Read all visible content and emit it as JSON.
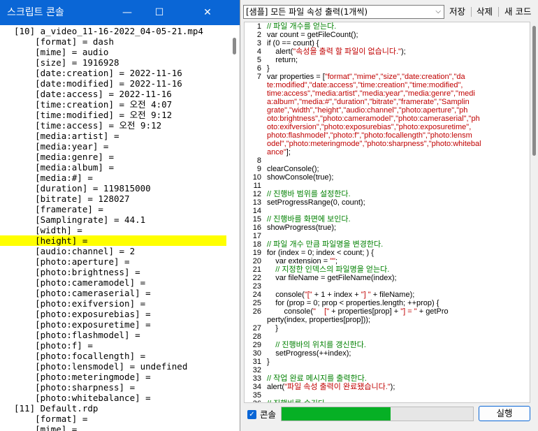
{
  "console_window": {
    "title": "스크립트 콘솔",
    "minimize_glyph": "—",
    "maximize_glyph": "☐",
    "close_glyph": "✕",
    "lines": [
      {
        "text": "[10] a_video_11-16-2022_04-05-21.mp4",
        "highlight": false
      },
      {
        "text": "    [format] = dash",
        "highlight": false
      },
      {
        "text": "    [mime] = audio",
        "highlight": false
      },
      {
        "text": "    [size] = 1916928",
        "highlight": false
      },
      {
        "text": "    [date:creation] = 2022-11-16",
        "highlight": false
      },
      {
        "text": "    [date:modified] = 2022-11-16",
        "highlight": false
      },
      {
        "text": "    [date:access] = 2022-11-16",
        "highlight": false
      },
      {
        "text": "    [time:creation] = 오전 4:07",
        "highlight": false
      },
      {
        "text": "    [time:modified] = 오전 9:12",
        "highlight": false
      },
      {
        "text": "    [time:access] = 오전 9:12",
        "highlight": false
      },
      {
        "text": "    [media:artist] =",
        "highlight": false
      },
      {
        "text": "    [media:year] =",
        "highlight": false
      },
      {
        "text": "    [media:genre] =",
        "highlight": false
      },
      {
        "text": "    [media:album] =",
        "highlight": false
      },
      {
        "text": "    [media:#] =",
        "highlight": false
      },
      {
        "text": "    [duration] = 119815000",
        "highlight": false
      },
      {
        "text": "    [bitrate] = 128027",
        "highlight": false
      },
      {
        "text": "    [framerate] =",
        "highlight": false
      },
      {
        "text": "    [Samplingrate] = 44.1",
        "highlight": false
      },
      {
        "text": "    [width] =",
        "highlight": false
      },
      {
        "text": "    [height] =",
        "highlight": true
      },
      {
        "text": "    [audio:channel] = 2",
        "highlight": false
      },
      {
        "text": "    [photo:aperture] =",
        "highlight": false
      },
      {
        "text": "    [photo:brightness] =",
        "highlight": false
      },
      {
        "text": "    [photo:cameramodel] =",
        "highlight": false
      },
      {
        "text": "    [photo:cameraserial] =",
        "highlight": false
      },
      {
        "text": "    [photo:exifversion] =",
        "highlight": false
      },
      {
        "text": "    [photo:exposurebias] =",
        "highlight": false
      },
      {
        "text": "    [photo:exposuretime] =",
        "highlight": false
      },
      {
        "text": "    [photo:flashmodel] =",
        "highlight": false
      },
      {
        "text": "    [photo:f] =",
        "highlight": false
      },
      {
        "text": "    [photo:focallength] =",
        "highlight": false
      },
      {
        "text": "    [photo:lensmodel] = undefined",
        "highlight": false
      },
      {
        "text": "    [photo:meteringmode] =",
        "highlight": false
      },
      {
        "text": "    [photo:sharpness] =",
        "highlight": false
      },
      {
        "text": "    [photo:whitebalance] =",
        "highlight": false
      },
      {
        "text": "[11] Default.rdp",
        "highlight": false
      },
      {
        "text": "    [format] =",
        "highlight": false
      },
      {
        "text": "    [mime] =",
        "highlight": false
      }
    ]
  },
  "editor": {
    "script_select": "[샘플] 모든 파일 속성 출력(1개씩)",
    "save_label": "저장",
    "delete_label": "삭제",
    "new_code_label": "새 코드",
    "code_lines": [
      {
        "num": "1",
        "parts": [
          {
            "t": "// 파일 개수를 얻는다.",
            "k": "c"
          }
        ]
      },
      {
        "num": "2",
        "parts": [
          {
            "t": "var count = getFileCount();",
            "k": ""
          }
        ]
      },
      {
        "num": "3",
        "parts": [
          {
            "t": "if (0 == count) {",
            "k": ""
          }
        ]
      },
      {
        "num": "4",
        "parts": [
          {
            "t": "    alert(",
            "k": ""
          },
          {
            "t": "\"속성을 출력 할 파일이 없습니다.\"",
            "k": "s"
          },
          {
            "t": ");",
            "k": ""
          }
        ]
      },
      {
        "num": "5",
        "parts": [
          {
            "t": "    return;",
            "k": ""
          }
        ]
      },
      {
        "num": "6",
        "parts": [
          {
            "t": "}",
            "k": ""
          }
        ]
      },
      {
        "num": "7",
        "parts": [
          {
            "t": "var properties = [",
            "k": ""
          },
          {
            "t": "\"format\",\"mime\",\"size\",\"date:creation\",\"da",
            "k": "s"
          }
        ]
      },
      {
        "num": "",
        "parts": [
          {
            "t": "te:modified\",\"date:access\",\"time:creation\",\"time:modified\",",
            "k": "s"
          }
        ]
      },
      {
        "num": "",
        "parts": [
          {
            "t": "time:access\",\"media:artist\",\"media:year\",\"media:genre\",\"medi",
            "k": "s"
          }
        ]
      },
      {
        "num": "",
        "parts": [
          {
            "t": "a:album\",\"media:#\",\"duration\",\"bitrate\",\"framerate\",\"Samplin",
            "k": "s"
          }
        ]
      },
      {
        "num": "",
        "parts": [
          {
            "t": "grate\",\"width\",\"height\",\"audio:channel\",\"photo:aperture\",\"ph",
            "k": "s"
          }
        ]
      },
      {
        "num": "",
        "parts": [
          {
            "t": "oto:brightness\",\"photo:cameramodel\",\"photo:cameraserial\",\"ph",
            "k": "s"
          }
        ]
      },
      {
        "num": "",
        "parts": [
          {
            "t": "oto:exifversion\",\"photo:exposurebias\",\"photo:exposuretime\",",
            "k": "s"
          }
        ]
      },
      {
        "num": "",
        "parts": [
          {
            "t": "photo:flashmodel\",\"photo:f\",\"photo:focallength\",\"photo:lensm",
            "k": "s"
          }
        ]
      },
      {
        "num": "",
        "parts": [
          {
            "t": "odel\",\"photo:meteringmode\",\"photo:sharpness\",\"photo:whitebal",
            "k": "s"
          }
        ]
      },
      {
        "num": "",
        "parts": [
          {
            "t": "ance\"",
            "k": "s"
          },
          {
            "t": "];",
            "k": ""
          }
        ]
      },
      {
        "num": "8",
        "parts": []
      },
      {
        "num": "9",
        "parts": [
          {
            "t": "clearConsole();",
            "k": ""
          }
        ]
      },
      {
        "num": "10",
        "parts": [
          {
            "t": "showConsole(true);",
            "k": ""
          }
        ]
      },
      {
        "num": "11",
        "parts": []
      },
      {
        "num": "12",
        "parts": [
          {
            "t": "// 진행바 범위를 설정한다.",
            "k": "c"
          }
        ]
      },
      {
        "num": "13",
        "parts": [
          {
            "t": "setProgressRange(0, count);",
            "k": ""
          }
        ]
      },
      {
        "num": "14",
        "parts": []
      },
      {
        "num": "15",
        "parts": [
          {
            "t": "// 진행바를 화면에 보인다.",
            "k": "c"
          }
        ]
      },
      {
        "num": "16",
        "parts": [
          {
            "t": "showProgress(true);",
            "k": ""
          }
        ]
      },
      {
        "num": "17",
        "parts": []
      },
      {
        "num": "18",
        "parts": [
          {
            "t": "// 파일 개수 만큼 파일명을 변경한다.",
            "k": "c"
          }
        ]
      },
      {
        "num": "19",
        "parts": [
          {
            "t": "for (index = 0; index < count; ) {",
            "k": ""
          }
        ]
      },
      {
        "num": "20",
        "parts": [
          {
            "t": "    var extension = ",
            "k": ""
          },
          {
            "t": "\"\"",
            "k": "s"
          },
          {
            "t": ";",
            "k": ""
          }
        ]
      },
      {
        "num": "21",
        "parts": [
          {
            "t": "    // 지정한 인덱스의 파일명을 얻는다.",
            "k": "c"
          }
        ]
      },
      {
        "num": "22",
        "parts": [
          {
            "t": "    var fileName = getFileName(index);",
            "k": ""
          }
        ]
      },
      {
        "num": "23",
        "parts": []
      },
      {
        "num": "24",
        "parts": [
          {
            "t": "    console(",
            "k": ""
          },
          {
            "t": "\"[\"",
            "k": "s"
          },
          {
            "t": " + 1 + index + ",
            "k": ""
          },
          {
            "t": "\"] \"",
            "k": "s"
          },
          {
            "t": " + fileName);",
            "k": ""
          }
        ]
      },
      {
        "num": "25",
        "parts": [
          {
            "t": "    for (prop = 0; prop < properties.length; ++prop) {",
            "k": ""
          }
        ]
      },
      {
        "num": "26",
        "parts": [
          {
            "t": "        console(",
            "k": ""
          },
          {
            "t": "\"    [\"",
            "k": "s"
          },
          {
            "t": " + properties[prop] + ",
            "k": ""
          },
          {
            "t": "\"] = \"",
            "k": "s"
          },
          {
            "t": " + getPro",
            "k": ""
          }
        ]
      },
      {
        "num": "",
        "parts": [
          {
            "t": "perty(index, properties[prop]));",
            "k": ""
          }
        ]
      },
      {
        "num": "27",
        "parts": [
          {
            "t": "    }",
            "k": ""
          }
        ]
      },
      {
        "num": "28",
        "parts": []
      },
      {
        "num": "29",
        "parts": [
          {
            "t": "    // 진행바의 위치를 갱신한다.",
            "k": "c"
          }
        ]
      },
      {
        "num": "30",
        "parts": [
          {
            "t": "    setProgress(++index);",
            "k": ""
          }
        ]
      },
      {
        "num": "31",
        "parts": [
          {
            "t": "}",
            "k": ""
          }
        ]
      },
      {
        "num": "32",
        "parts": []
      },
      {
        "num": "33",
        "parts": [
          {
            "t": "// 작업 완료 메시지를 출력한다.",
            "k": "c"
          }
        ]
      },
      {
        "num": "34",
        "parts": [
          {
            "t": "alert(",
            "k": ""
          },
          {
            "t": "\"파일 속성 출력이 완료됐습니다.\"",
            "k": "s"
          },
          {
            "t": ");",
            "k": ""
          }
        ]
      },
      {
        "num": "35",
        "parts": []
      },
      {
        "num": "36",
        "parts": [
          {
            "t": "// 진행바를 숨긴다.",
            "k": "c"
          }
        ]
      }
    ]
  },
  "bottom": {
    "console_checked": true,
    "console_label": "콘솔",
    "progress_fraction": 0.57,
    "run_label": "실행"
  },
  "colors": {
    "titlebar": "#0a66d6",
    "highlight": "#ffff00",
    "string": "#c00000",
    "comment": "#008000",
    "progress": "#06b025"
  },
  "icons": {
    "select_arrow": "chevron-down-icon",
    "checkbox": "check-icon"
  }
}
